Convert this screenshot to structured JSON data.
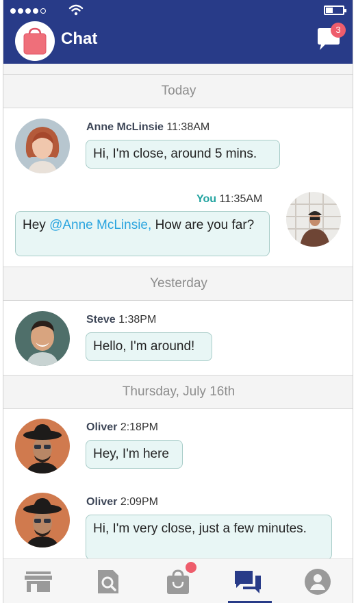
{
  "header": {
    "title": "Chat",
    "message_badge": "3"
  },
  "separators": {
    "today": "Today",
    "yesterday": "Yesterday",
    "thursday": "Thursday, July 16th"
  },
  "messages": [
    {
      "sender": "Anne McLinsie",
      "time": "11:38AM",
      "text": "Hi, I'm close, around 5 mins."
    },
    {
      "sender": "You",
      "time": "11:35AM",
      "mention": "@Anne McLinsie,",
      "text": "How are you far?"
    },
    {
      "sender": "Steve",
      "time": "1:38PM",
      "text": "Hello, I'm around!"
    },
    {
      "sender": "Oliver",
      "time": "2:18PM",
      "text": "Hey, I'm here"
    },
    {
      "sender": "Oliver",
      "time": "2:09PM",
      "text": "Hi, I'm very close, just a few minutes."
    }
  ],
  "nav": {
    "items": [
      "store",
      "search",
      "cart",
      "chat",
      "profile"
    ],
    "active": "chat"
  },
  "colors": {
    "header": "#283b88",
    "accent": "#21a3a0",
    "mention": "#2aa4df",
    "badge": "#ee5d6c",
    "bubble": "#e8f6f5"
  }
}
